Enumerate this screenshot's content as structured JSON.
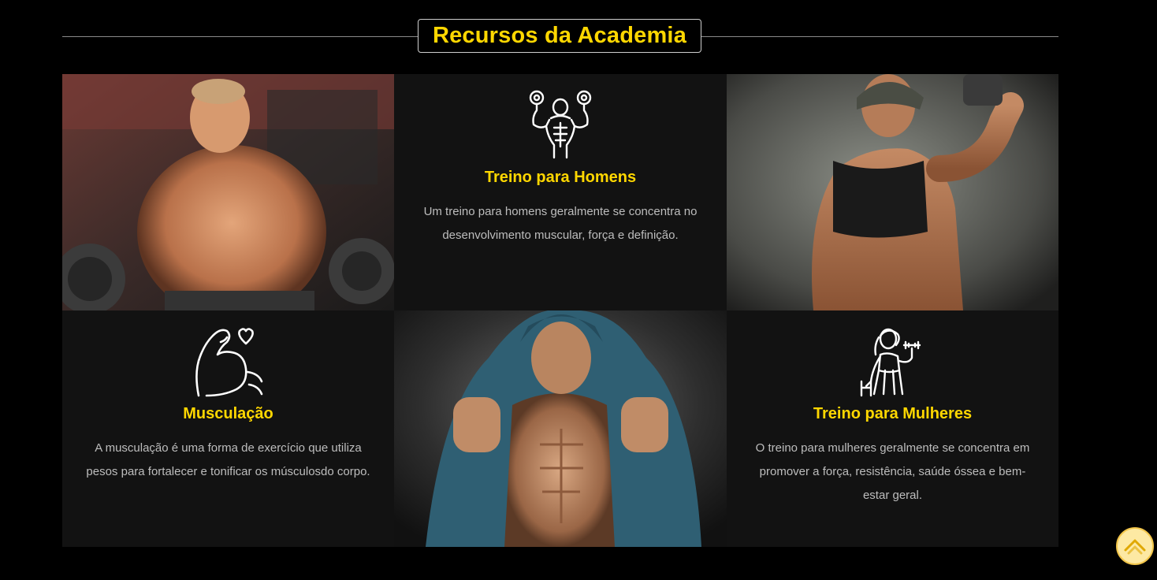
{
  "section": {
    "title": "Recursos da Academia"
  },
  "cards": [
    {
      "icon": "bodybuilder-dumbbells-icon",
      "title": "Treino para Homens",
      "text": "Um treino para homens geralmente se concentra no desenvolvimento muscular, força e definição."
    },
    {
      "icon": "flexed-arm-heart-icon",
      "title": "Musculação",
      "text": "A musculação é uma forma de exercício que utiliza pesos para fortalecer e tonificar os músculosdo corpo."
    },
    {
      "icon": "woman-dumbbell-icon",
      "title": "Treino para Mulheres",
      "text": "O treino para mulheres geralmente se concentra em promover a força, resistência, saúde óssea e bem-estar geral."
    }
  ],
  "photos": [
    "man-lifting-dumbbells-photo",
    "woman-fitness-photo",
    "man-hoodie-abs-photo"
  ],
  "colors": {
    "accent": "#ffd700",
    "background": "#000000",
    "card_bg": "#121212",
    "text_muted": "#bdbdbd",
    "scroll_button": "#fde9a3"
  }
}
